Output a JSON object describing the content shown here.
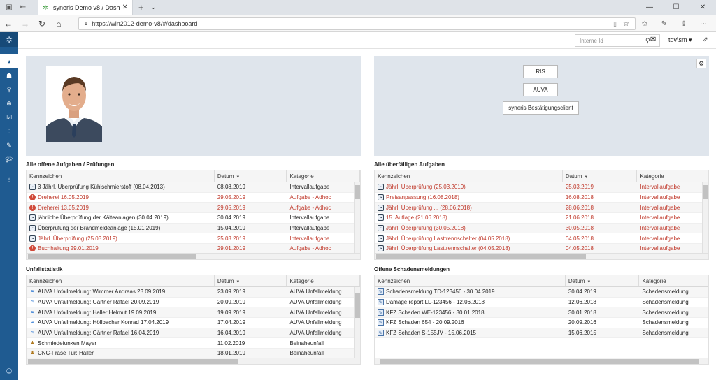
{
  "browser": {
    "tab_title": "syneris Demo v8 / Dash",
    "url": "https://win2012-demo-v8/#/dashboard"
  },
  "topbar": {
    "search_placeholder": "Interne Id",
    "user": "tdv\\sm ▾"
  },
  "launcher": {
    "buttons": [
      "RIS",
      "AUVA",
      "syneris Bestätigungsclient"
    ]
  },
  "grids": {
    "open_tasks": {
      "title": "Alle offene Aufgaben / Prüfungen",
      "headers": [
        "Kennzeichen",
        "Datum",
        "Kategorie"
      ],
      "rows": [
        {
          "c1": "3 Jährl. Überprüfung Kühlschmierstoff (08.04.2013)",
          "c2": "08.08.2019",
          "c3": "Intervallaufgabe",
          "red": false,
          "icon": "task"
        },
        {
          "c1": "Dreherei 16.05.2019",
          "c2": "29.05.2019",
          "c3": "Aufgabe - Adhoc",
          "red": true,
          "icon": "adhoc"
        },
        {
          "c1": "Dreherei 13.05.2019",
          "c2": "29.05.2019",
          "c3": "Aufgabe - Adhoc",
          "red": true,
          "icon": "adhoc"
        },
        {
          "c1": "jährliche Überprüfung der Kälteanlagen (30.04.2019)",
          "c2": "30.04.2019",
          "c3": "Intervallaufgabe",
          "red": false,
          "icon": "task"
        },
        {
          "c1": "Überprüfung der Brandmeldeanlage (15.01.2019)",
          "c2": "15.04.2019",
          "c3": "Intervallaufgabe",
          "red": false,
          "icon": "task"
        },
        {
          "c1": "Jährl. Überprüfung (25.03.2019)",
          "c2": "25.03.2019",
          "c3": "Intervallaufgabe",
          "red": true,
          "icon": "task"
        },
        {
          "c1": "Buchhaltung 29.01.2019",
          "c2": "29.01.2019",
          "c3": "Aufgabe - Adhoc",
          "red": true,
          "icon": "adhoc"
        }
      ]
    },
    "overdue_tasks": {
      "title": "Alle überfälligen Aufgaben",
      "headers": [
        "Kennzeichen",
        "Datum",
        "Kategorie"
      ],
      "rows": [
        {
          "c1": "Jährl. Überprüfung (25.03.2019)",
          "c2": "25.03.2019",
          "c3": "Intervallaufgabe",
          "red": true,
          "icon": "task"
        },
        {
          "c1": "Preisanpassung (16.08.2018)",
          "c2": "16.08.2018",
          "c3": "Intervallaufgabe",
          "red": true,
          "icon": "task"
        },
        {
          "c1": "Jährl. Überprüfung ... (28.06.2018)",
          "c2": "28.06.2018",
          "c3": "Intervallaufgabe",
          "red": true,
          "icon": "task"
        },
        {
          "c1": "15. Auflage (21.06.2018)",
          "c2": "21.06.2018",
          "c3": "Intervallaufgabe",
          "red": true,
          "icon": "task"
        },
        {
          "c1": "Jährl. Überprüfung (30.05.2018)",
          "c2": "30.05.2018",
          "c3": "Intervallaufgabe",
          "red": true,
          "icon": "task"
        },
        {
          "c1": "Jährl. Überprüfung Lasttrennschalter (04.05.2018)",
          "c2": "04.05.2018",
          "c3": "Intervallaufgabe",
          "red": true,
          "icon": "task"
        },
        {
          "c1": "Jährl. Überprüfung Lasttrennschalter (04.05.2018)",
          "c2": "04.05.2018",
          "c3": "Intervallaufgabe",
          "red": true,
          "icon": "task"
        }
      ]
    },
    "accident_stats": {
      "title": "Unfallstatistik",
      "headers": [
        "Kennzeichen",
        "Datum",
        "Kategorie"
      ],
      "rows": [
        {
          "c1": "AUVA Unfallmeldung: Wimmer Andreas 23.09.2019",
          "c2": "23.09.2019",
          "c3": "AUVA Unfallmeldung",
          "red": false,
          "icon": "auva"
        },
        {
          "c1": "AUVA Unfallmeldung: Gärtner Rafael 20.09.2019",
          "c2": "20.09.2019",
          "c3": "AUVA Unfallmeldung",
          "red": false,
          "icon": "auva"
        },
        {
          "c1": "AUVA Unfallmeldung: Haller Helmut 19.09.2019",
          "c2": "19.09.2019",
          "c3": "AUVA Unfallmeldung",
          "red": false,
          "icon": "auva"
        },
        {
          "c1": "AUVA Unfallmeldung: Höllbacher Konrad 17.04.2019",
          "c2": "17.04.2019",
          "c3": "AUVA Unfallmeldung",
          "red": false,
          "icon": "auva"
        },
        {
          "c1": "AUVA Unfallmeldung: Gärtner Rafael 16.04.2019",
          "c2": "16.04.2019",
          "c3": "AUVA Unfallmeldung",
          "red": false,
          "icon": "auva"
        },
        {
          "c1": "Schmiedefunken Mayer",
          "c2": "11.02.2019",
          "c3": "Beinaheunfall",
          "red": false,
          "icon": "person"
        },
        {
          "c1": "CNC-Fräse Tür: Haller",
          "c2": "18.01.2019",
          "c3": "Beinaheunfall",
          "red": false,
          "icon": "person"
        }
      ]
    },
    "damage_reports": {
      "title": "Offene Schadensmeldungen",
      "headers": [
        "Kennzeichen",
        "Datum",
        "Kategorie"
      ],
      "rows": [
        {
          "c1": "Schadensmeldung TD-123456 - 30.04.2019",
          "c2": "30.04.2019",
          "c3": "Schadensmeldung",
          "red": false,
          "icon": "dmg"
        },
        {
          "c1": "Damage report LL-123456 - 12.06.2018",
          "c2": "12.06.2018",
          "c3": "Schadensmeldung",
          "red": false,
          "icon": "dmg"
        },
        {
          "c1": "KFZ Schaden WE-123456 - 30.01.2018",
          "c2": "30.01.2018",
          "c3": "Schadensmeldung",
          "red": false,
          "icon": "dmg"
        },
        {
          "c1": "KFZ Schaden 654 - 20.09.2016",
          "c2": "20.09.2016",
          "c3": "Schadensmeldung",
          "red": false,
          "icon": "dmg"
        },
        {
          "c1": "KFZ Schaden S-155JV - 15.06.2015",
          "c2": "15.06.2015",
          "c3": "Schadensmeldung",
          "red": false,
          "icon": "dmg"
        }
      ]
    }
  },
  "colors": {
    "sidebar": "#1f5b91",
    "panel": "#dfe5ec",
    "overdue_red": "#c0392b"
  }
}
